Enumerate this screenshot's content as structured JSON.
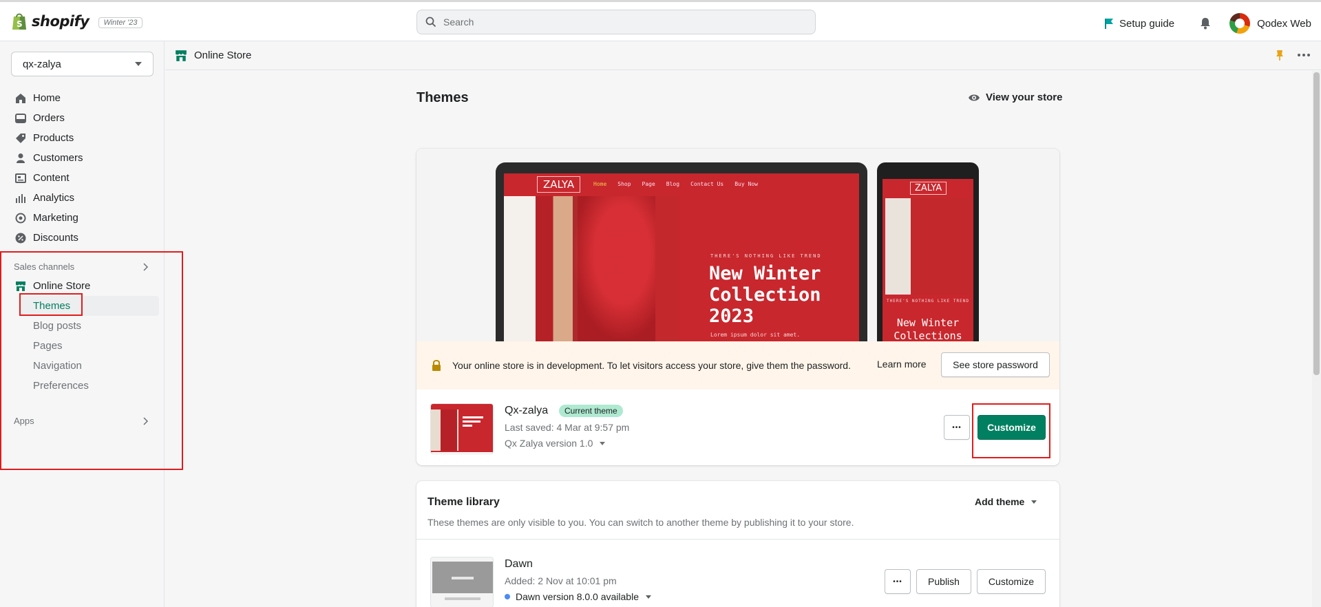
{
  "topbar": {
    "brand": "shopify",
    "edition": "Winter '23",
    "search_placeholder": "Search",
    "setup_guide": "Setup guide",
    "user_name": "Qodex Web"
  },
  "sidebar": {
    "store_name": "qx-zalya",
    "items": [
      {
        "label": "Home",
        "icon": "home-icon"
      },
      {
        "label": "Orders",
        "icon": "orders-icon"
      },
      {
        "label": "Products",
        "icon": "tag-icon"
      },
      {
        "label": "Customers",
        "icon": "person-icon"
      },
      {
        "label": "Content",
        "icon": "content-icon"
      },
      {
        "label": "Analytics",
        "icon": "bar-chart-icon"
      },
      {
        "label": "Marketing",
        "icon": "target-icon"
      },
      {
        "label": "Discounts",
        "icon": "discount-icon"
      }
    ],
    "sales_channels_label": "Sales channels",
    "online_store_label": "Online Store",
    "online_store_sub": [
      "Themes",
      "Blog posts",
      "Pages",
      "Navigation",
      "Preferences"
    ],
    "apps_label": "Apps"
  },
  "context_bar": {
    "title": "Online Store"
  },
  "page": {
    "title": "Themes",
    "view_store": "View your store"
  },
  "preview": {
    "laptop": {
      "logo": "ZALYA",
      "nav_links": [
        "Home",
        "Shop",
        "Page",
        "Blog",
        "Contact Us",
        "Buy Now"
      ],
      "subheading": "THERE'S NOTHING LIKE TREND",
      "headline": [
        "New Winter",
        "Collection",
        "2023"
      ],
      "lorem": "Lorem ipsum dolor sit amet."
    },
    "phone": {
      "logo": "ZALYA",
      "subheading": "THERE'S NOTHING LIKE TREND",
      "headline": [
        "New Winter",
        "Collections"
      ]
    }
  },
  "banner": {
    "text": "Your online store is in development. To let visitors access your store, give them the password.",
    "learn_more": "Learn more",
    "button": "See store password"
  },
  "current_theme": {
    "name": "Qx-zalya",
    "badge": "Current theme",
    "last_saved": "Last saved: 4 Mar at 9:57 pm",
    "version": "Qx Zalya version 1.0",
    "more_label": "•••",
    "customize": "Customize"
  },
  "library": {
    "title": "Theme library",
    "description": "These themes are only visible to you. You can switch to another theme by publishing it to your store.",
    "add_theme": "Add theme",
    "themes": [
      {
        "name": "Dawn",
        "added": "Added: 2 Nov at 10:01 pm",
        "version": "Dawn version 8.0.0 available",
        "more_label": "•••",
        "publish": "Publish",
        "customize": "Customize"
      }
    ]
  },
  "colors": {
    "primary_green": "#008060",
    "active_nav": "#007f5f",
    "annotation_red": "#e21b1b",
    "theme_red": "#c8272d"
  }
}
